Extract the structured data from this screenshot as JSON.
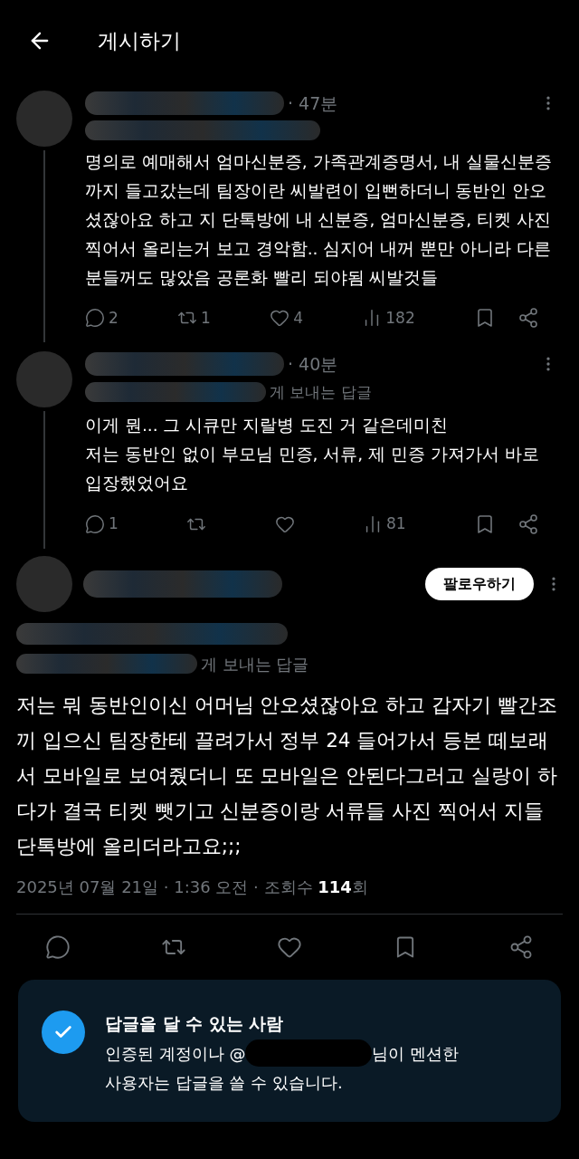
{
  "header": {
    "title": "게시하기"
  },
  "replies": [
    {
      "time": "· 47분",
      "text": "명의로 예매해서 엄마신분증, 가족관계증명서, 내 실물신분증까지 들고갔는데 팀장이란 씨발련이 입뻔하더니 동반인 안오셨잖아요 하고 지 단톡방에 내 신분증, 엄마신분증, 티켓 사진 찍어서 올리는거 보고 경악함.. 심지어 내꺼 뿐만 아니라 다른분들꺼도 많았음 공론화 빨리 되야됨 씨발것들",
      "stats": {
        "replies": "2",
        "reposts": "1",
        "likes": "4",
        "views": "182"
      }
    },
    {
      "time": "· 40분",
      "reply_to": "게 보내는 답글",
      "text": "이게 뭔... 그 시큐만 지랄병 도진 거 같은데미친\n저는 동반인 없이 부모님 민증, 서류, 제 민증 가져가서 바로 입장했었어요",
      "stats": {
        "replies": "1",
        "views": "81"
      }
    }
  ],
  "main_post": {
    "follow_label": "팔로우하기",
    "reply_to": "게 보내는 답글",
    "text": "저는 뭐 동반인이신 어머님 안오셨잖아요 하고 갑자기 빨간조끼 입으신 팀장한테 끌려가서 정부 24 들어가서 등본 떼보래서 모바일로 보여줬더니 또 모바일은 안된다그러고 실랑이 하다가 결국 티켓 뺏기고 신분증이랑 서류들 사진 찍어서 지들 단톡방에 올리더라고요;;;",
    "date": "2025년 07월 21일 · 1:36 오전 · 조회수 ",
    "views": "114",
    "views_unit": "회"
  },
  "reply_notice": {
    "title": "답글을 달 수 있는 사람",
    "line_1_start": "인증된 계정이나 @",
    "line_1_end": "님이 멘션한",
    "line_2": "사용자는 답글을 쓸 수 있습니다."
  }
}
